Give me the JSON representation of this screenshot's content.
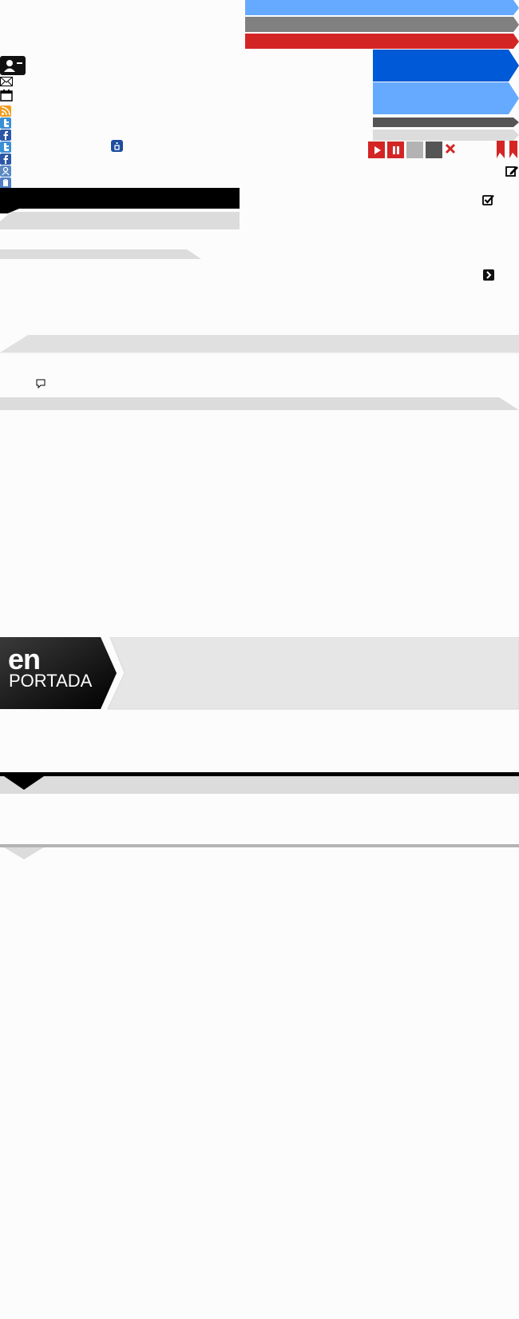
{
  "branding": {
    "en_label": "en",
    "portada_label": "PORTADA"
  },
  "icons": {
    "contact": "contact-card-icon",
    "mail": "mail-icon",
    "calendar": "calendar-icon",
    "rss": "rss-icon",
    "twitter": "twitter-icon",
    "facebook": "facebook-icon",
    "bookmark": "bookmark-icon",
    "play": "play-icon",
    "pause": "pause-icon",
    "close": "close-icon",
    "edit": "edit-icon",
    "checkbox": "checkbox-checked-icon",
    "next": "chevron-right-icon",
    "comment": "comment-icon"
  },
  "colors": {
    "light_blue": "#66aaff",
    "gray": "#808080",
    "red": "#d42525",
    "blue": "#0059d6",
    "dark_gray": "#555555",
    "light_gray": "#dcdcdc",
    "black": "#000000"
  }
}
